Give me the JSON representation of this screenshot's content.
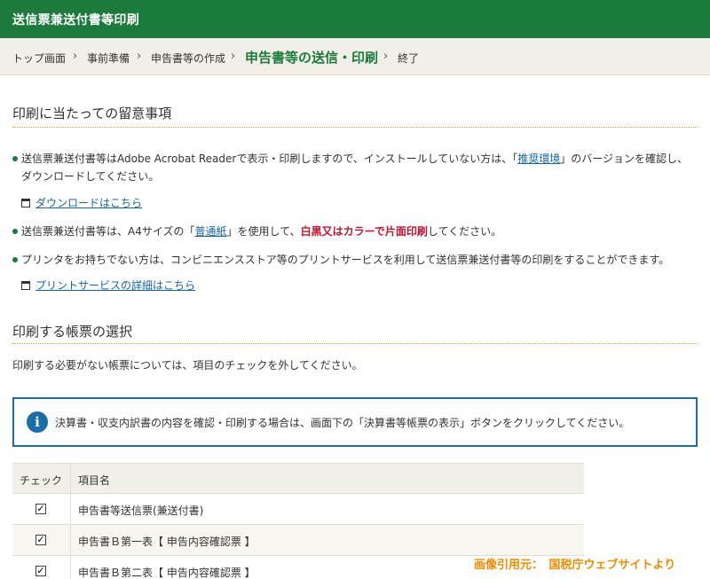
{
  "header": {
    "title": "送信票兼送付書等印刷"
  },
  "breadcrumb": {
    "items": [
      "トップ画面",
      "事前準備",
      "申告書等の作成",
      "申告書等の送信・印刷",
      "終了"
    ],
    "separator": "›"
  },
  "notes": {
    "title": "印刷に当たっての留意事項",
    "b1_pre": "送信票兼送付書等はAdobe Acrobat Readerで表示・印刷しますので、インストールしていない方は、「",
    "b1_link": "推奨環境",
    "b1_post": "」のバージョンを確認し、ダウンロードしてください。",
    "download_link": "ダウンロードはこちら",
    "b2_pre": "送信票兼送付書等は、A4サイズの「",
    "b2_link": "普通紙",
    "b2_mid": "」を使用して、",
    "b2_red": "白黒又はカラーで片面印刷",
    "b2_post": "してください。",
    "b3": "プリンタをお持ちでない方は、コンビニエンスストア等のプリントサービスを利用して送信票兼送付書等の印刷をすることができます。",
    "print_service_link": "プリントサービスの詳細はこちら"
  },
  "selection": {
    "title": "印刷する帳票の選択",
    "description": "印刷する必要がない帳票については、項目のチェックを外してください。",
    "info_icon": "i",
    "info_text": "決算書・収支内訳書の内容を確認・印刷する場合は、画面下の「決算書等帳票の表示」ボタンをクリックしてください。"
  },
  "table": {
    "headers": [
      "チェック",
      "項目名"
    ],
    "rows": [
      {
        "checked": true,
        "check_mark": "✓",
        "name": "申告書等送信票(兼送付書)"
      },
      {
        "checked": true,
        "check_mark": "✓",
        "name": "申告書Ｂ第一表【 申告内容確認票 】"
      },
      {
        "checked": true,
        "check_mark": "✓",
        "name": "申告書Ｂ第二表【 申告内容確認票 】"
      }
    ]
  },
  "credit": "画像引用元：　国税庁ウェブサイトより",
  "colors": {
    "header_green": "#1c7b3c",
    "info_blue": "#1b6fa7",
    "credit_orange": "#f08c00",
    "accent_red": "#c8102e"
  }
}
